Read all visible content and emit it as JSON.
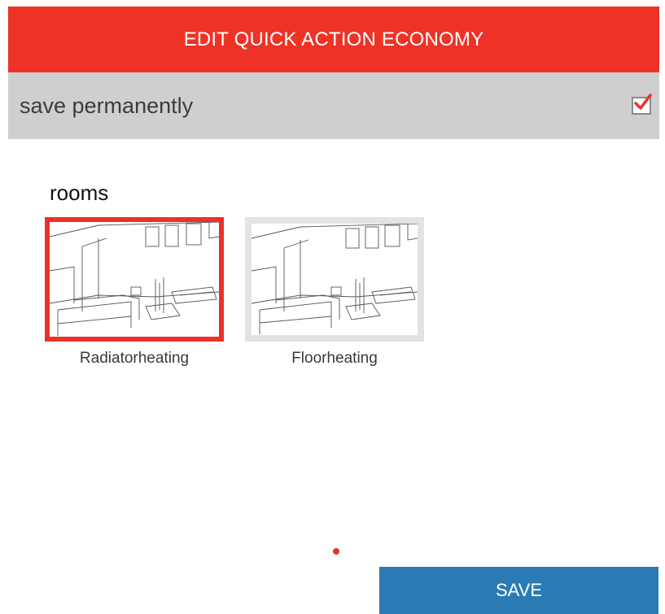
{
  "header": {
    "title": "EDIT QUICK ACTION ECONOMY",
    "background": "#ee3326"
  },
  "settings": {
    "save_permanently_label": "save permanently",
    "save_permanently_checked": true
  },
  "rooms": {
    "title": "rooms",
    "items": [
      {
        "label": "Radiatorheating",
        "selected": true,
        "icon": "room-sketch-image"
      },
      {
        "label": "Floorheating",
        "selected": false,
        "icon": "room-sketch-image"
      }
    ]
  },
  "pager": {
    "pages": 1,
    "current": 1
  },
  "footer": {
    "save_label": "SAVE",
    "save_color": "#2a7bb3"
  }
}
